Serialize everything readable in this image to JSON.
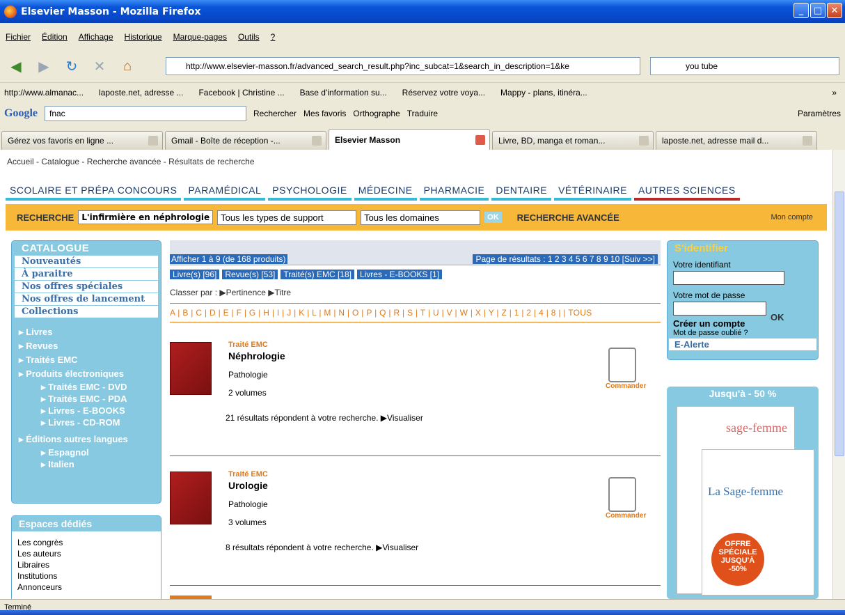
{
  "window": {
    "title": "Elsevier Masson - Mozilla Firefox"
  },
  "menubar": {
    "items": [
      "Fichier",
      "Édition",
      "Affichage",
      "Historique",
      "Marque-pages",
      "Outils",
      "?"
    ]
  },
  "navbar": {
    "url": "http://www.elsevier-masson.fr/advanced_search_result.php?inc_subcat=1&search_in_description=1&ke",
    "search_value": "you tube"
  },
  "bookmarks": {
    "items": [
      "http://www.almanac...",
      "laposte.net, adresse ...",
      "Facebook | Christine ...",
      "Base d'information su...",
      "Réservez votre voya...",
      "Mappy - plans, itinéra...",
      "»"
    ]
  },
  "google_toolbar": {
    "logo": "Google",
    "search_value": "fnac",
    "rechercher": "Rechercher",
    "mes_favoris": "Mes favoris",
    "orthographe": "Orthographe",
    "traduire": "Traduire",
    "parametres": "Paramètres"
  },
  "tabs": [
    {
      "label": "Gérez vos favoris en ligne ...",
      "active": false
    },
    {
      "label": "Gmail - Boîte de réception -...",
      "active": false
    },
    {
      "label": "Elsevier Masson",
      "active": true
    },
    {
      "label": "Livre, BD, manga et roman...",
      "active": false
    },
    {
      "label": "laposte.net, adresse mail d...",
      "active": false
    }
  ],
  "page": {
    "breadcrumb": "Accueil - Catalogue - Recherche avancée - Résultats de recherche",
    "topnav": [
      "SCOLAIRE ET PRÉPA CONCOURS",
      "PARAMÉDICAL",
      "PSYCHOLOGIE",
      "MÉDECINE",
      "PHARMACIE",
      "DENTAIRE",
      "VÉTÉRINAIRE",
      "AUTRES SCIENCES"
    ],
    "search": {
      "label": "RECHERCHE",
      "term": "L'infirmière en néphrologie",
      "support": "Tous les types de support",
      "domaine": "Tous les domaines",
      "ok": "OK",
      "avancee": "RECHERCHE AVANCÉE",
      "mon_compte": "Mon compte"
    },
    "catalogue": {
      "title": "CATALOGUE",
      "white_items": [
        "Nouveautés",
        "À paraitre",
        "Nos offres spéciales",
        "Nos offres de lancement",
        "Collections"
      ],
      "links": [
        "▸ Livres",
        "▸ Revues",
        "▸ Traités EMC",
        "▸ Produits électroniques"
      ],
      "sublinks1": [
        "▸ Traités EMC - DVD",
        "▸ Traités EMC - PDA",
        "▸ Livres - E-BOOKS",
        "▸ Livres - CD-ROM"
      ],
      "editions": "▸ Éditions autres langues",
      "sublinks2": [
        "▸ Espagnol",
        "▸ Italien"
      ]
    },
    "espaces": {
      "title": "Espaces dédiés",
      "items": [
        "Les congrès",
        "Les auteurs",
        "Libraires",
        "Institutions",
        "Annonceurs"
      ]
    },
    "results": {
      "afficher": "Afficher 1 à 9 (de 168 produits)",
      "pages": "Page de résultats : 1 2 3 4 5 6 7 8 9 10 [Suiv >>]",
      "filters": [
        "Livre(s) [96]",
        "Revue(s) [53]",
        "Traité(s) EMC [18]",
        "Livres - E-BOOKS [1]"
      ],
      "classer": "Classer par : ▶Pertinence   ▶Titre",
      "alpha": "A | B | C | D | E | F | G | H | I | J | K | L | M | N | O | P | Q | R | S | T | U | V | W | X | Y | Z | 1 | 2 | 4 | 8 |   | TOUS",
      "products": [
        {
          "tag": "Traité EMC",
          "title": "Néphrologie",
          "line1": "Pathologie",
          "line2": "2 volumes",
          "line3": "21 résultats répondent à votre recherche. ▶Visualiser",
          "cmd": "Commander"
        },
        {
          "tag": "Traité EMC",
          "title": "Urologie",
          "line1": "Pathologie",
          "line2": "3 volumes",
          "line3": "8 résultats répondent à votre recherche. ▶Visualiser",
          "cmd": "Commander"
        }
      ]
    },
    "identifier": {
      "title": "S'identifier",
      "login_label": "Votre identifiant",
      "password_label": "Votre mot de passe",
      "ok": "OK",
      "creer": "Créer un compte",
      "oublie": "Mot de passe oublié ?",
      "ealerte": "E-Alerte"
    },
    "promo": {
      "title": "Jusqu'à - 50 %",
      "mag1": "sage-femme",
      "mag2": "La Sage-femme",
      "offre": "OFFRE SPÉCIALE JUSQU'À -50%"
    }
  },
  "status": "Terminé"
}
